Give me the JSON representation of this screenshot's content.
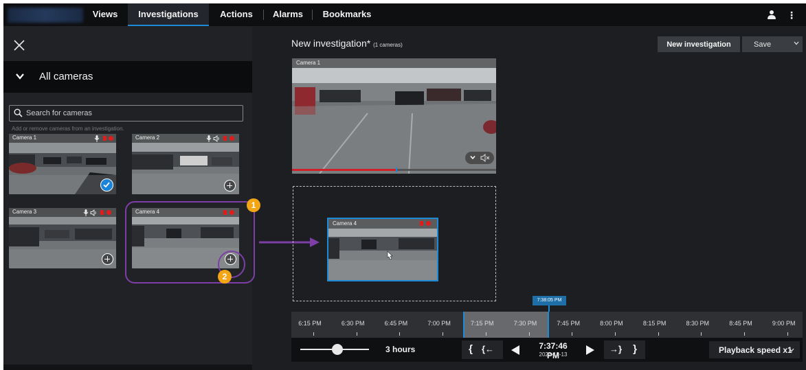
{
  "nav": {
    "tabs": [
      {
        "label": "Views"
      },
      {
        "label": "Investigations"
      },
      {
        "label": "Actions"
      },
      {
        "label": "Alarms"
      },
      {
        "label": "Bookmarks"
      }
    ],
    "active_tab": "Investigations"
  },
  "sidebar": {
    "section_title": "All cameras",
    "search": {
      "placeholder": "Search for cameras",
      "value": ""
    },
    "hint": "Add or remove cameras from an investigation.",
    "cameras": [
      {
        "name": "Camera 1",
        "in_investigation": true
      },
      {
        "name": "Camera 2",
        "in_investigation": false
      },
      {
        "name": "Camera 3",
        "in_investigation": false
      },
      {
        "name": "Camera 4",
        "in_investigation": false
      }
    ]
  },
  "annotations": {
    "step1": "1",
    "step2": "2"
  },
  "investigation": {
    "title": "New investigation*",
    "camera_count": "(1 cameras)",
    "new_button": "New investigation",
    "save_button": "Save",
    "view_camera": "Camera 1",
    "dragging_camera": "Camera 4",
    "playback_progress": 0.51
  },
  "timeline": {
    "cursor_time": "7:38:05 PM",
    "tick_labels": [
      "6:15 PM",
      "6:30 PM",
      "6:45 PM",
      "7:00 PM",
      "7:15 PM",
      "7:30 PM",
      "7:45 PM",
      "8:00 PM",
      "8:15 PM",
      "8:30 PM",
      "8:45 PM",
      "9:00 PM"
    ],
    "selection": [
      "7:08 PM",
      "7:38 PM"
    ]
  },
  "controls": {
    "range": "3 hours",
    "current_time": "7:37:46 PM",
    "current_date": "2022-12-13",
    "playback_speed": "Playback speed x1"
  },
  "colors": {
    "accent": "#1d8ad8",
    "annotation": "#7d3fa7",
    "badge": "#f2a615",
    "record": "#e21b1b"
  }
}
